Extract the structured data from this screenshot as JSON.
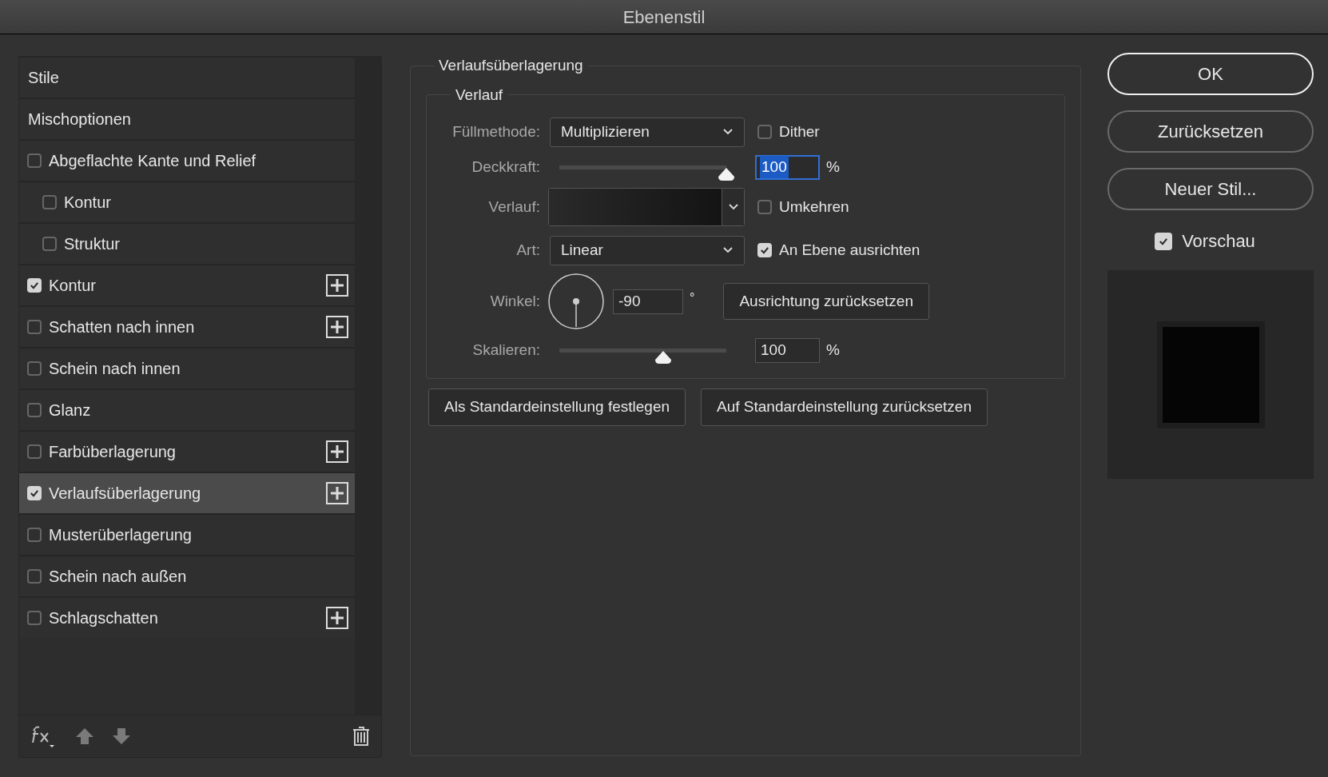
{
  "window": {
    "title": "Ebenenstil"
  },
  "styles_list": {
    "items": [
      {
        "label": "Stile",
        "kind": "header",
        "selected": false
      },
      {
        "label": "Mischoptionen",
        "kind": "header",
        "selected": false
      },
      {
        "label": "Abgeflachte Kante und Relief",
        "kind": "effect",
        "checked": false,
        "selected": false,
        "add_button": false,
        "children": [
          {
            "label": "Kontur",
            "kind": "effect",
            "checked": false,
            "selected": false,
            "add_button": false
          },
          {
            "label": "Struktur",
            "kind": "effect",
            "checked": false,
            "selected": false,
            "add_button": false
          }
        ]
      },
      {
        "label": "Kontur",
        "kind": "effect",
        "checked": true,
        "selected": false,
        "add_button": true
      },
      {
        "label": "Schatten nach innen",
        "kind": "effect",
        "checked": false,
        "selected": false,
        "add_button": true
      },
      {
        "label": "Schein nach innen",
        "kind": "effect",
        "checked": false,
        "selected": false,
        "add_button": false
      },
      {
        "label": "Glanz",
        "kind": "effect",
        "checked": false,
        "selected": false,
        "add_button": false
      },
      {
        "label": "Farbüberlagerung",
        "kind": "effect",
        "checked": false,
        "selected": false,
        "add_button": true
      },
      {
        "label": "Verlaufsüberlagerung",
        "kind": "effect",
        "checked": true,
        "selected": true,
        "add_button": true
      },
      {
        "label": "Musterüberlagerung",
        "kind": "effect",
        "checked": false,
        "selected": false,
        "add_button": false
      },
      {
        "label": "Schein nach außen",
        "kind": "effect",
        "checked": false,
        "selected": false,
        "add_button": false
      },
      {
        "label": "Schlagschatten",
        "kind": "effect",
        "checked": false,
        "selected": false,
        "add_button": true
      }
    ]
  },
  "gradient_overlay": {
    "title": "Verlaufsüberlagerung",
    "group_title": "Verlauf",
    "blend_mode": {
      "label": "Füllmethode:",
      "value": "Multiplizieren"
    },
    "dither": {
      "label": "Dither",
      "checked": false
    },
    "opacity": {
      "label": "Deckkraft:",
      "level": 1.0,
      "value": "100",
      "unit": "%",
      "focused": true
    },
    "gradient": {
      "label": "Verlauf:"
    },
    "reverse": {
      "label": "Umkehren",
      "checked": false
    },
    "style": {
      "label": "Art:",
      "value": "Linear"
    },
    "align_with_layer": {
      "label": "An Ebene ausrichten",
      "checked": true
    },
    "angle": {
      "label": "Winkel:",
      "value": "-90",
      "unit": "°"
    },
    "reset_alignment": "Ausrichtung zurücksetzen",
    "scale": {
      "label": "Skalieren:",
      "level": 0.62,
      "value": "100",
      "unit": "%",
      "focused": false
    },
    "buttons": [
      "Als Standardeinstellung festlegen",
      "Auf Standardeinstellung zurücksetzen"
    ]
  },
  "actions": {
    "buttons": [
      {
        "label": "OK",
        "default": true
      },
      {
        "label": "Zurücksetzen",
        "default": false
      },
      {
        "label": "Neuer Stil...",
        "default": false
      }
    ],
    "preview": {
      "label": "Vorschau",
      "checked": true
    }
  }
}
